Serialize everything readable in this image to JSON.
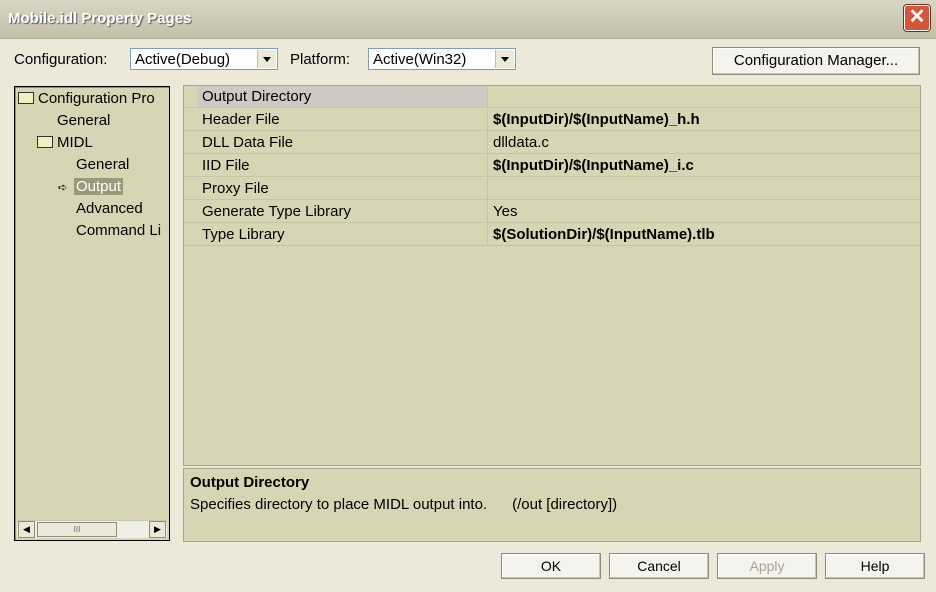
{
  "window": {
    "title": "Mobile.idl Property Pages"
  },
  "toolbar": {
    "configuration_label": "Configuration:",
    "configuration_value": "Active(Debug)",
    "platform_label": "Platform:",
    "platform_value": "Active(Win32)",
    "config_manager_label": "Configuration Manager..."
  },
  "tree": {
    "root": "Configuration Pro",
    "general": "General",
    "midl": "MIDL",
    "midl_general": "General",
    "midl_output": "Output",
    "midl_advanced": "Advanced",
    "midl_command": "Command Li",
    "scroll_thumb": "III"
  },
  "properties": [
    {
      "name": "Output Directory",
      "value": ""
    },
    {
      "name": "Header File",
      "value": "$(InputDir)/$(InputName)_h.h"
    },
    {
      "name": "DLL Data File",
      "value": "dlldata.c"
    },
    {
      "name": "IID File",
      "value": "$(InputDir)/$(InputName)_i.c"
    },
    {
      "name": "Proxy File",
      "value": ""
    },
    {
      "name": "Generate Type Library",
      "value": "Yes"
    },
    {
      "name": "Type Library",
      "value": "$(SolutionDir)/$(InputName).tlb"
    }
  ],
  "description": {
    "title": "Output Directory",
    "text": "Specifies directory to place MIDL output into.      (/out [directory])"
  },
  "buttons": {
    "ok": "OK",
    "cancel": "Cancel",
    "apply": "Apply",
    "help": "Help"
  }
}
